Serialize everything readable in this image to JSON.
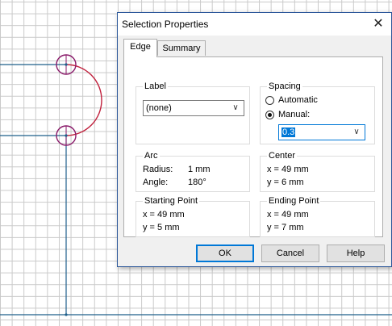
{
  "dialog": {
    "title": "Selection Properties",
    "close_glyph": "✕",
    "tabs": [
      {
        "label": "Edge",
        "active": true
      },
      {
        "label": "Summary",
        "active": false
      }
    ],
    "label_group": {
      "title": "Label",
      "selected": "(none)"
    },
    "spacing_group": {
      "title": "Spacing",
      "automatic_label": "Automatic",
      "manual_label": "Manual:",
      "selected_option": "Manual",
      "manual_value": "0.3"
    },
    "arc_group": {
      "title": "Arc",
      "radius_label": "Radius:",
      "radius_value": "1 mm",
      "angle_label": "Angle:",
      "angle_value": "180°"
    },
    "center_group": {
      "title": "Center",
      "x": "x = 49 mm",
      "y": "y = 6 mm"
    },
    "start_group": {
      "title": "Starting Point",
      "x": "x = 49 mm",
      "y": "y = 5 mm"
    },
    "end_group": {
      "title": "Ending Point",
      "x": "x = 49 mm",
      "y": "y = 7 mm"
    },
    "buttons": {
      "ok": "OK",
      "cancel": "Cancel",
      "help": "Help"
    }
  },
  "colors": {
    "edge_line": "#1f5f8b",
    "arc": "#c0203c",
    "vertex_circle": "#8a1a6a",
    "accent": "#0078d7"
  }
}
